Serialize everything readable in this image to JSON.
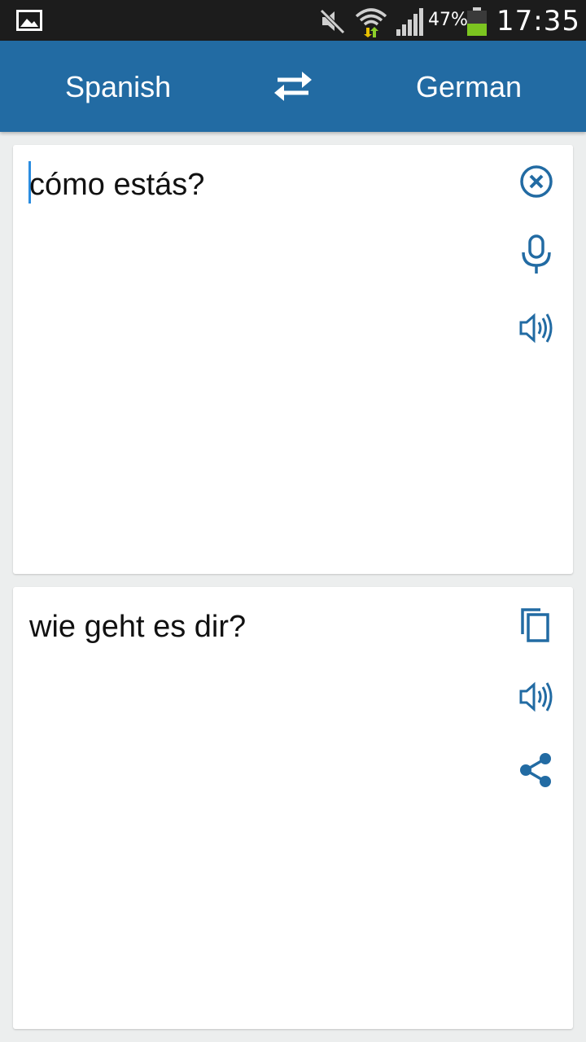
{
  "status_bar": {
    "battery_percent": "47%",
    "battery_level": 0.47,
    "time": "17:35",
    "icons": [
      "gallery-icon",
      "mute-icon",
      "wifi-icon",
      "signal-icon",
      "battery-icon"
    ]
  },
  "header": {
    "source_language": "Spanish",
    "target_language": "German",
    "swap_icon": "swap-icon",
    "background": "#226ba3"
  },
  "input_card": {
    "text": "cómo estás?",
    "actions": [
      "clear-icon",
      "microphone-icon",
      "speaker-icon"
    ]
  },
  "output_card": {
    "text": "wie geht es dir?",
    "actions": [
      "copy-icon",
      "speaker-icon",
      "share-icon"
    ]
  },
  "colors": {
    "accent": "#226ba3",
    "cursor": "#2b8de0",
    "background": "#eceeee"
  }
}
